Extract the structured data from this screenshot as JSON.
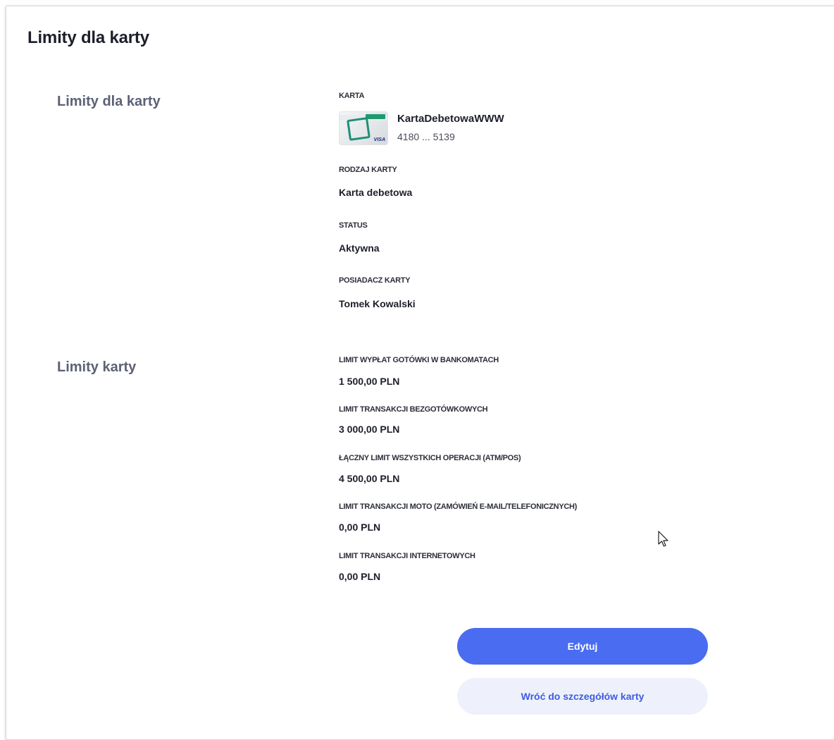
{
  "page": {
    "title": "Limity dla karty"
  },
  "section_card": {
    "title": "Limity dla karty",
    "card_label": "KARTA",
    "card_name": "KartaDebetowaWWW",
    "card_number": "4180 ... 5139",
    "card_brand": "VISA",
    "type_label": "RODZAJ KARTY",
    "type_value": "Karta debetowa",
    "status_label": "STATUS",
    "status_value": "Aktywna",
    "holder_label": "POSIADACZ KARTY",
    "holder_value": "Tomek Kowalski"
  },
  "section_limits": {
    "title": "Limity karty",
    "items": [
      {
        "label": "LIMIT WYPŁAT GOTÓWKI W BANKOMATACH",
        "value": "1 500,00 PLN"
      },
      {
        "label": "LIMIT TRANSAKCJI BEZGOTÓWKOWYCH",
        "value": "3 000,00 PLN"
      },
      {
        "label": "ŁĄCZNY LIMIT WSZYSTKICH OPERACJI (ATM/POS)",
        "value": "4 500,00 PLN"
      },
      {
        "label": "LIMIT TRANSAKCJI MOTO (ZAMÓWIEŃ E-MAIL/TELEFONICZNYCH)",
        "value": "0,00 PLN"
      },
      {
        "label": "LIMIT TRANSAKCJI INTERNETOWYCH",
        "value": "0,00 PLN"
      }
    ]
  },
  "actions": {
    "edit_label": "Edytuj",
    "back_label": "Wróć do szczegółów karty"
  },
  "colors": {
    "primary": "#4a6cf0",
    "secondary_bg": "#eef1fb",
    "secondary_text": "#3d5ce0",
    "section_title": "#5c6175"
  }
}
